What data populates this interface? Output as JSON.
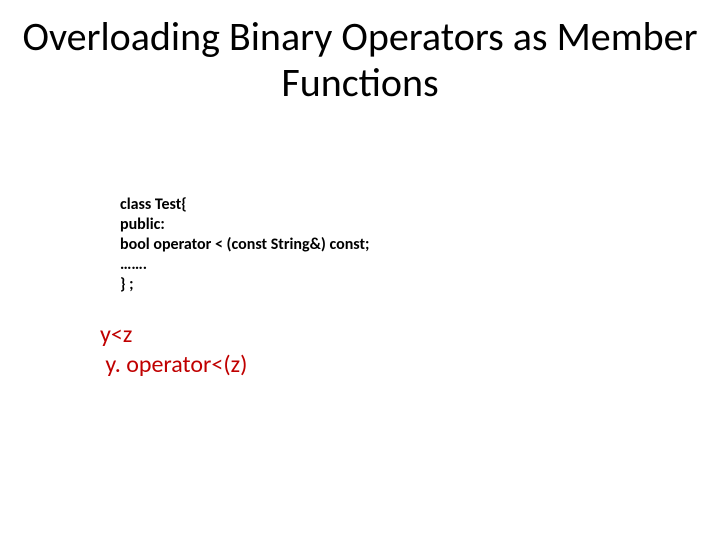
{
  "title": "Overloading Binary Operators as\nMember Functions",
  "code": {
    "l1": "class Test{",
    "l2": "public:",
    "l3": "bool operator < (const String&) const;",
    "l4": "…….",
    "l5": "} ;"
  },
  "example": {
    "l1": "y<z",
    "l2": " y. operator<(z)"
  }
}
